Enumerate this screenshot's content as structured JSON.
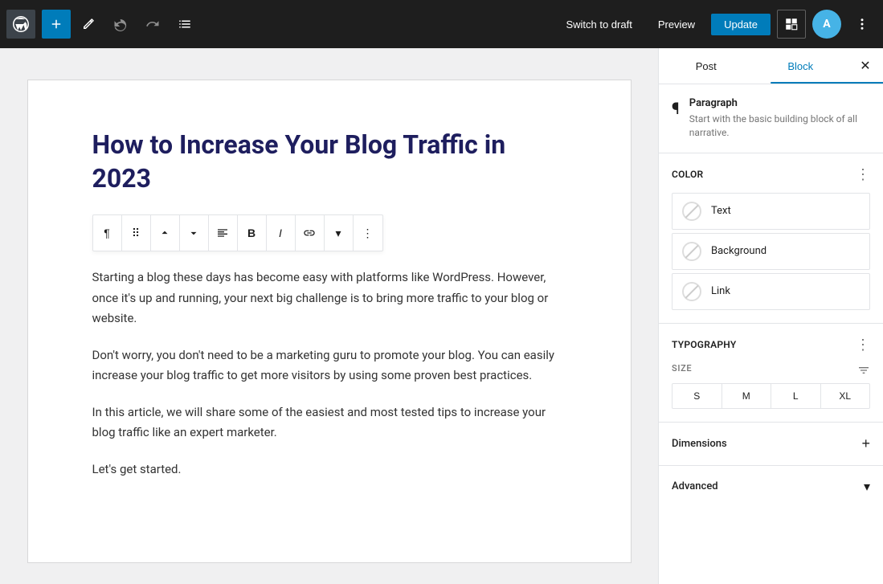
{
  "toolbar": {
    "add_label": "+",
    "undo_label": "↩",
    "redo_label": "↪",
    "list_view_label": "☰",
    "switch_draft_label": "Switch to draft",
    "preview_label": "Preview",
    "update_label": "Update"
  },
  "post": {
    "title": "How to Increase Your Blog Traffic in 2023",
    "paragraphs": [
      "Starting a blog these days has become easy with platforms like WordPress. However, once it's up and running, your next big challenge is to bring more traffic to your blog or website.",
      "Don't worry, you don't need to be a marketing guru to promote your blog. You can easily increase your blog traffic to get more visitors by using some proven best practices.",
      "In this article, we will share some of the easiest and most tested tips to increase your blog traffic like an expert marketer.",
      "Let's get started."
    ]
  },
  "sidebar": {
    "tab_post": "Post",
    "tab_block": "Block",
    "block_name": "Paragraph",
    "block_desc": "Start with the basic building block of all narrative.",
    "color_section_title": "Color",
    "color_options": [
      {
        "label": "Text"
      },
      {
        "label": "Background"
      },
      {
        "label": "Link"
      }
    ],
    "typography_title": "Typography",
    "size_label": "SIZE",
    "size_options": [
      "S",
      "M",
      "L",
      "XL"
    ],
    "dimensions_title": "Dimensions",
    "advanced_title": "Advanced"
  }
}
